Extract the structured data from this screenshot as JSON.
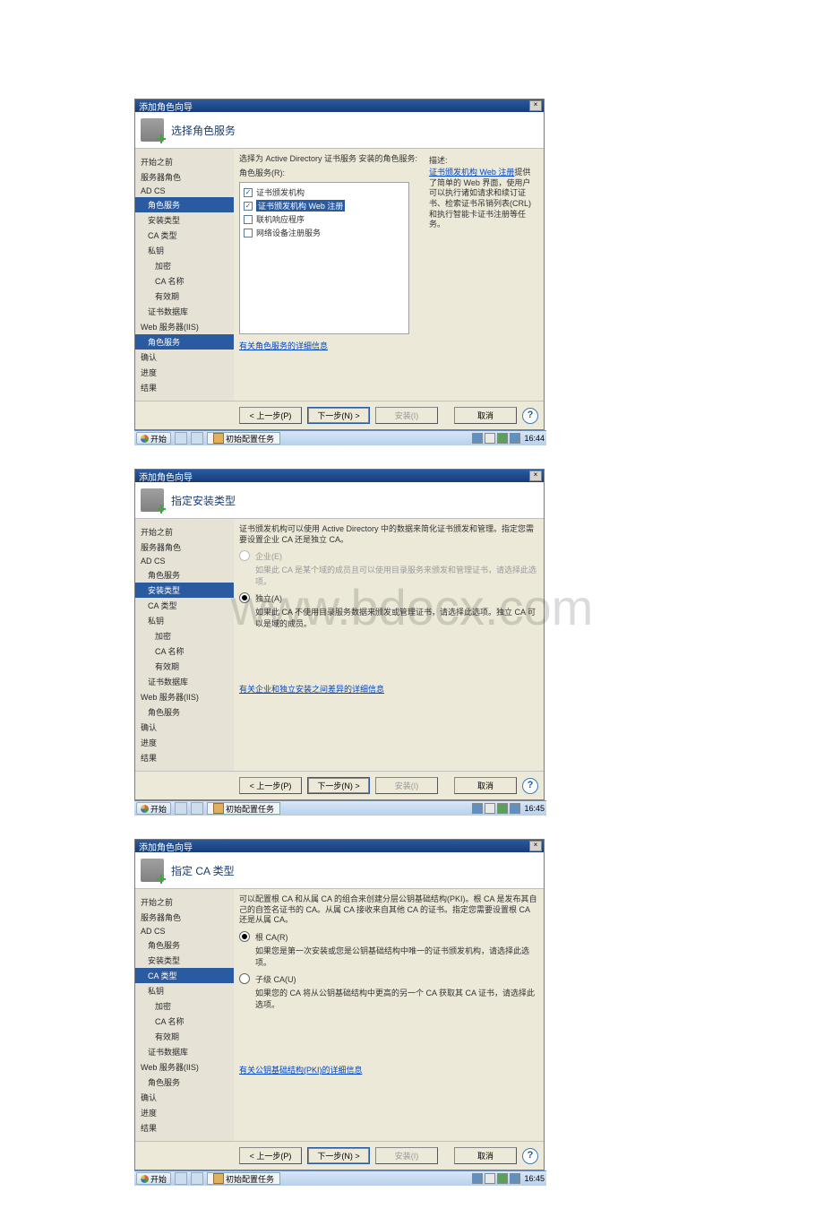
{
  "watermark": "www.bdocx.com",
  "sidebar_items": [
    {
      "label": "开始之前",
      "indent": 0
    },
    {
      "label": "服务器角色",
      "indent": 0
    },
    {
      "label": "AD CS",
      "indent": 0
    },
    {
      "label": "角色服务",
      "indent": 1
    },
    {
      "label": "安装类型",
      "indent": 1
    },
    {
      "label": "CA 类型",
      "indent": 1
    },
    {
      "label": "私钥",
      "indent": 1
    },
    {
      "label": "加密",
      "indent": 2
    },
    {
      "label": "CA 名称",
      "indent": 2
    },
    {
      "label": "有效期",
      "indent": 2
    },
    {
      "label": "证书数据库",
      "indent": 1
    },
    {
      "label": "Web 服务器(IIS)",
      "indent": 0
    },
    {
      "label": "角色服务",
      "indent": 1
    },
    {
      "label": "确认",
      "indent": 0
    },
    {
      "label": "进度",
      "indent": 0
    },
    {
      "label": "结果",
      "indent": 0
    }
  ],
  "buttons": {
    "prev": "< 上一步(P)",
    "next": "下一步(N) >",
    "install": "安装(I)",
    "cancel": "取消"
  },
  "taskbar": {
    "start": "开始",
    "task_label": "初始配置任务"
  },
  "wizards": [
    {
      "title": "添加角色向导",
      "page_title": "选择角色服务",
      "selected_sidebar": "角色服务",
      "time": "16:44",
      "content": {
        "instr": "选择为 Active Directory 证书服务 安装的角色服务:",
        "subinstr": "角色服务(R):",
        "checkboxes": [
          {
            "label": "证书颁发机构",
            "checked": true,
            "selected": false
          },
          {
            "label": "证书颁发机构 Web 注册",
            "checked": true,
            "selected": true
          },
          {
            "label": "联机响应程序",
            "checked": false,
            "selected": false
          },
          {
            "label": "网络设备注册服务",
            "checked": false,
            "selected": false
          }
        ],
        "desc_title": "描述:",
        "desc_link": "证书颁发机构 Web 注册",
        "desc_body": "提供了简单的 Web 界面，使用户可以执行诸如请求和续订证书、检索证书吊销列表(CRL)和执行智能卡证书注册等任务。",
        "detail_link": "有关角色服务的详细信息"
      }
    },
    {
      "title": "添加角色向导",
      "page_title": "指定安装类型",
      "selected_sidebar": "安装类型",
      "time": "16:45",
      "content": {
        "instr": "证书颁发机构可以使用 Active Directory 中的数据来简化证书颁发和管理。指定您需要设置企业 CA 还是独立 CA。",
        "radios": [
          {
            "label": "企业(E)",
            "sub": "如果此 CA 是某个域的成员且可以使用目录服务来颁发和管理证书，请选择此选项。",
            "checked": false,
            "disabled": true
          },
          {
            "label": "独立(A)",
            "sub": "如果此 CA 不使用目录服务数据来颁发或管理证书，请选择此选项。独立 CA 可以是域的成员。",
            "checked": true,
            "disabled": false
          }
        ],
        "detail_link": "有关企业和独立安装之间差异的详细信息"
      }
    },
    {
      "title": "添加角色向导",
      "page_title": "指定 CA 类型",
      "selected_sidebar": "CA 类型",
      "time": "16:45",
      "content": {
        "instr": "可以配置根 CA 和从属 CA 的组合来创建分层公钥基础结构(PKI)。根 CA 是发布其自己的自签名证书的 CA。从属 CA 接收来自其他 CA 的证书。指定您需要设置根 CA 还是从属 CA。",
        "radios": [
          {
            "label": "根 CA(R)",
            "sub": "如果您是第一次安装或您是公钥基础结构中唯一的证书颁发机构，请选择此选项。",
            "checked": true,
            "disabled": false
          },
          {
            "label": "子级 CA(U)",
            "sub": "如果您的 CA 将从公钥基础结构中更高的另一个 CA 获取其 CA 证书，请选择此选项。",
            "checked": false,
            "disabled": false
          }
        ],
        "detail_link": "有关公钥基础结构(PKI)的详细信息"
      }
    }
  ]
}
